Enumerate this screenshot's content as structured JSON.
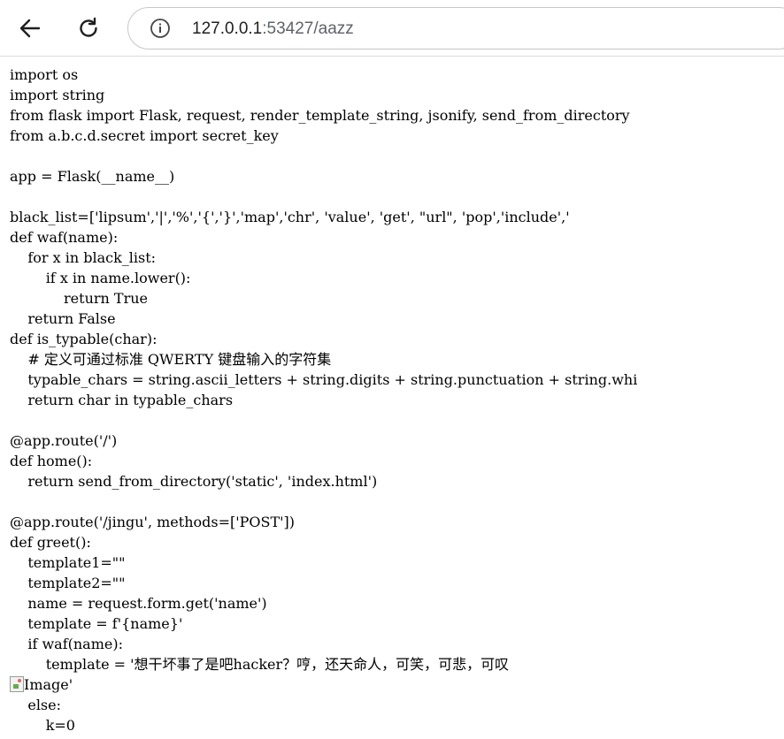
{
  "browser": {
    "back_icon": "arrow-left-icon",
    "reload_icon": "reload-icon",
    "site_info_icon": "info-icon",
    "url_host": "127.0.0.1",
    "url_rest": ":53427/aazz"
  },
  "code_lines_before_image": [
    "import os",
    "import string",
    "from flask import Flask, request, render_template_string, jsonify, send_from_directory",
    "from a.b.c.d.secret import secret_key",
    "",
    "app = Flask(__name__)",
    "",
    "black_list=['lipsum','|','%','{','}','map','chr', 'value', 'get', \"url\", 'pop','include','",
    "def waf(name):",
    "    for x in black_list:",
    "        if x in name.lower():",
    "            return True",
    "    return False",
    "def is_typable(char):",
    "    # 定义可通过标准 QWERTY 键盘输入的字符集",
    "    typable_chars = string.ascii_letters + string.digits + string.punctuation + string.whi",
    "    return char in typable_chars",
    "",
    "@app.route('/')",
    "def home():",
    "    return send_from_directory('static', 'index.html')",
    "",
    "@app.route('/jingu', methods=['POST'])",
    "def greet():",
    "    template1=\"\"",
    "    template2=\"\"",
    "    name = request.form.get('name')",
    "    template = f'{name}'",
    "    if waf(name):",
    "        template = '想干坏事了是吧hacker？哼，还天命人，可笑，可悲，可叹"
  ],
  "broken_image_alt": "Image",
  "broken_image_suffix": "'",
  "code_lines_after_image": [
    "    else:",
    "        k=0"
  ]
}
